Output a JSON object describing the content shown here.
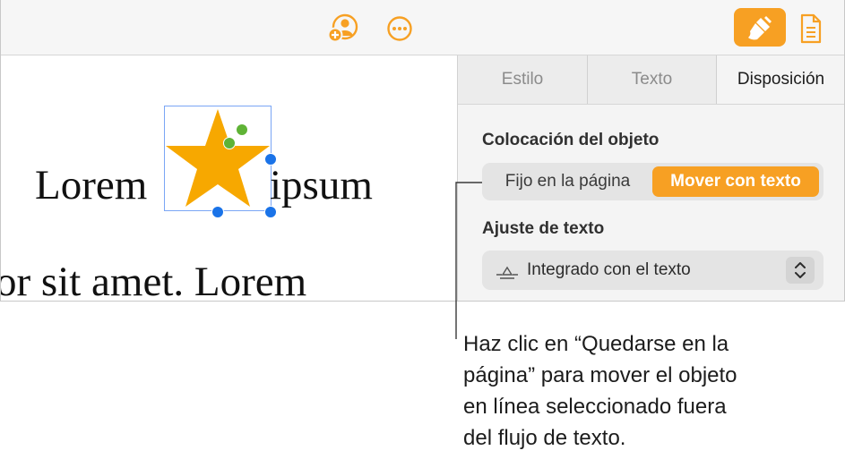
{
  "toolbar": {
    "collaborate_icon": "person-add-icon",
    "more_icon": "ellipsis-icon",
    "format_icon": "paintbrush-icon",
    "document_icon": "document-icon",
    "accent_color": "#f7a023"
  },
  "document": {
    "word_before": "Lorem",
    "word_after": "ipsum",
    "second_line": "or sit amet. Lorem",
    "inline_object": "star-shape",
    "star_color": "#f7a800"
  },
  "sidebar": {
    "tabs": [
      {
        "label": "Estilo",
        "active": false
      },
      {
        "label": "Texto",
        "active": false
      },
      {
        "label": "Disposición",
        "active": true
      }
    ],
    "placement_title": "Colocación del objeto",
    "placement_options": [
      {
        "label": "Fijo en la página",
        "selected": false
      },
      {
        "label": "Mover con texto",
        "selected": true
      }
    ],
    "wrap_title": "Ajuste de texto",
    "wrap_value": "Integrado con el texto"
  },
  "callout": {
    "lines": [
      "Haz clic en “Quedarse en la",
      "página” para mover el objeto",
      "en línea seleccionado fuera",
      "del flujo de texto."
    ]
  }
}
